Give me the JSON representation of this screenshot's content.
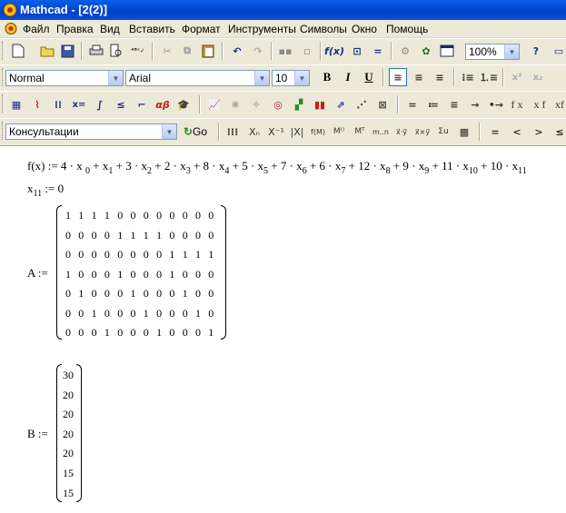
{
  "window": {
    "title": "Mathcad - [2(2)]",
    "icon": "mathcad-icon"
  },
  "menu": [
    "Файл",
    "Правка",
    "Вид",
    "Вставить",
    "Формат",
    "Инструменты",
    "Символы",
    "Окно",
    "Помощь"
  ],
  "toolbar_standard": {
    "zoom": "100%"
  },
  "toolbar_format": {
    "style": "Normal",
    "font": "Arial",
    "size": "10",
    "bold": "B",
    "italic": "I",
    "underline": "U"
  },
  "toolbar_math": {
    "consult": "Консультации",
    "go": "Go"
  },
  "symbols": {
    "equals": "=",
    "lt": "<",
    "gt": ">",
    "le": "≤"
  },
  "doc": {
    "f_def": "f(x) := 4 · x",
    "terms": [
      {
        "sub": "0",
        "op": " + x"
      },
      {
        "sub": "1",
        "op": " + 3 · x"
      },
      {
        "sub": "2",
        "op": " + 2 · x"
      },
      {
        "sub": "3",
        "op": " + 8 · x"
      },
      {
        "sub": "4",
        "op": " + 5 · x"
      },
      {
        "sub": "5",
        "op": " + 7 · x"
      },
      {
        "sub": "6",
        "op": " + 6 · x"
      },
      {
        "sub": "7",
        "op": " + 12 · x"
      },
      {
        "sub": "8",
        "op": " + 9 · x"
      },
      {
        "sub": "9",
        "op": " + 11 · x"
      },
      {
        "sub": "10",
        "op": " + 10 · x"
      },
      {
        "sub": "11",
        "op": ""
      }
    ],
    "x11_name": "x",
    "x11_sub": "11",
    "x11_val": " := 0",
    "A_label": "A :=",
    "A": [
      [
        1,
        1,
        1,
        1,
        0,
        0,
        0,
        0,
        0,
        0,
        0,
        0
      ],
      [
        0,
        0,
        0,
        0,
        1,
        1,
        1,
        1,
        0,
        0,
        0,
        0
      ],
      [
        0,
        0,
        0,
        0,
        0,
        0,
        0,
        0,
        1,
        1,
        1,
        1
      ],
      [
        1,
        0,
        0,
        0,
        1,
        0,
        0,
        0,
        1,
        0,
        0,
        0
      ],
      [
        0,
        1,
        0,
        0,
        0,
        1,
        0,
        0,
        0,
        1,
        0,
        0
      ],
      [
        0,
        0,
        1,
        0,
        0,
        0,
        1,
        0,
        0,
        0,
        1,
        0
      ],
      [
        0,
        0,
        0,
        1,
        0,
        0,
        0,
        1,
        0,
        0,
        0,
        1
      ]
    ],
    "B_label": "B :=",
    "B": [
      30,
      20,
      20,
      20,
      20,
      15,
      15
    ]
  }
}
